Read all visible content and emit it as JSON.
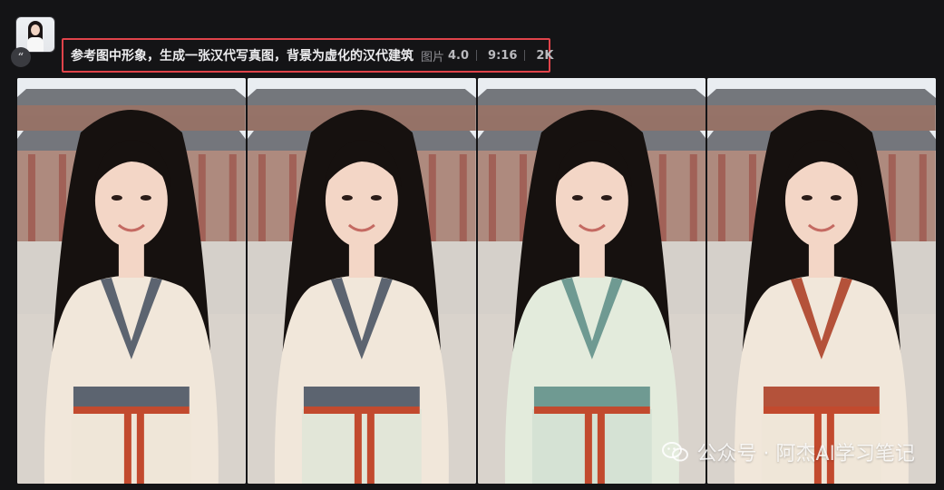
{
  "reference": {
    "quote_glyph": "“"
  },
  "prompt": {
    "text": "参考图中形象，生成一张汉代写真图，背景为虚化的汉代建筑",
    "image_label": "图片",
    "model_version": "4.0",
    "aspect_ratio": "9:16",
    "resolution": "2K"
  },
  "images": [
    {
      "dress": "ivory",
      "collar": "slate",
      "belt": "#c24a2e",
      "skirt": "#efe6d8"
    },
    {
      "dress": "ivory",
      "collar": "slate",
      "belt": "#c24a2e",
      "skirt": "#e2e6d8"
    },
    {
      "dress": "pale-green",
      "collar": "teal",
      "belt": "#c24a2e",
      "skirt": "#d5e2d4"
    },
    {
      "dress": "ivory",
      "collar": "rust",
      "belt": "#c24a2e",
      "skirt": "#efe6d8"
    }
  ],
  "watermark": {
    "text": "公众号 · 阿杰AI学习笔记"
  },
  "colors": {
    "background": "#141416",
    "highlight_border": "#e0434a",
    "hair": "#16110f",
    "skin": "#f3d6c6",
    "roof": "#4d4f55",
    "pillar": "#8a3324"
  }
}
